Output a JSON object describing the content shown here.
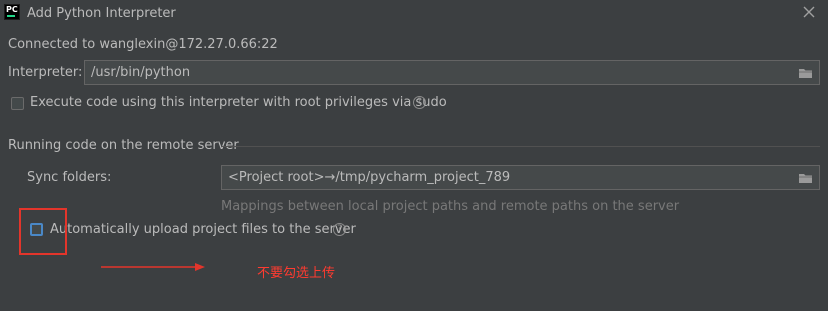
{
  "dialog": {
    "title": "Add Python Interpreter",
    "app_icon_text": "PC"
  },
  "connection": {
    "text": "Connected to wanglexin@172.27.0.66:22"
  },
  "interpreter": {
    "label": "Interpreter:",
    "value": "/usr/bin/python"
  },
  "sudo": {
    "label": "Execute code using this interpreter with root privileges via sudo",
    "checked": false,
    "help": "?"
  },
  "remote_section": {
    "title": "Running code on the remote server",
    "sync_label": "Sync folders:",
    "sync_value": "<Project root>→/tmp/pycharm_project_789",
    "mappings_hint": "Mappings between local project paths and remote paths on the server",
    "auto_upload_label": "Automatically upload project files to the server",
    "auto_upload_checked": false,
    "help": "?"
  },
  "annotation": {
    "text": "不要勾选上传",
    "color": "#ff3b30"
  },
  "colors": {
    "background": "#3c3f41",
    "field_bg": "#45494a",
    "text": "#bbbbbb",
    "hint": "#787878",
    "annotation_red": "#e3352b",
    "highlight_blue": "#4a88c7"
  }
}
